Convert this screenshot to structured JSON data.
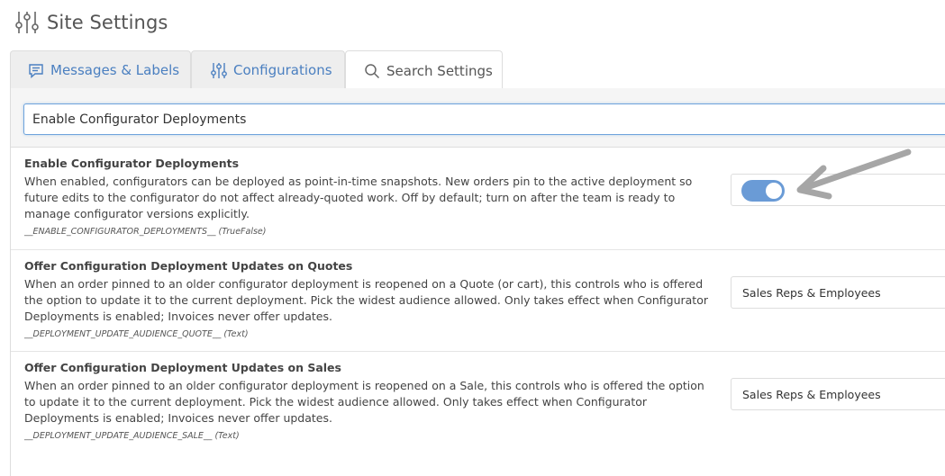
{
  "header": {
    "title": "Site Settings",
    "icon": "sliders-icon"
  },
  "tabs": [
    {
      "label": "Messages & Labels",
      "icon": "message-icon",
      "active": false
    },
    {
      "label": "Configurations",
      "icon": "sliders-icon",
      "active": false
    },
    {
      "label": "Search Settings",
      "icon": "search-icon",
      "active": true
    }
  ],
  "search": {
    "value": "Enable Configurator Deployments"
  },
  "settings": [
    {
      "name": "Enable Configurator Deployments",
      "description": "When enabled, configurators can be deployed as point-in-time snapshots. New orders pin to the active deployment so future edits to the configurator do not affect already-quoted work. Off by default; turn on after the team is ready to manage configurator versions explicitly.",
      "key": "__ENABLE_CONFIGURATOR_DEPLOYMENTS__ (TrueFalse)",
      "control": "toggle",
      "toggle_on": true
    },
    {
      "name": "Offer Configuration Deployment Updates on Quotes",
      "description": "When an order pinned to an older configurator deployment is reopened on a Quote (or cart), this controls who is offered the option to update it to the current deployment. Pick the widest audience allowed. Only takes effect when Configurator Deployments is enabled; Invoices never offer updates.",
      "key": "__DEPLOYMENT_UPDATE_AUDIENCE_QUOTE__ (Text)",
      "control": "select",
      "value": "Sales Reps & Employees"
    },
    {
      "name": "Offer Configuration Deployment Updates on Sales",
      "description": "When an order pinned to an older configurator deployment is reopened on a Sale, this controls who is offered the option to update it to the current deployment. Pick the widest audience allowed. Only takes effect when Configurator Deployments is enabled; Invoices never offer updates.",
      "key": "__DEPLOYMENT_UPDATE_AUDIENCE_SALE__ (Text)",
      "control": "select",
      "value": "Sales Reps & Employees"
    }
  ],
  "colors": {
    "accent": "#6a9bd6",
    "tab_link": "#4a7fc0",
    "arrow": "#a6a6a6"
  }
}
